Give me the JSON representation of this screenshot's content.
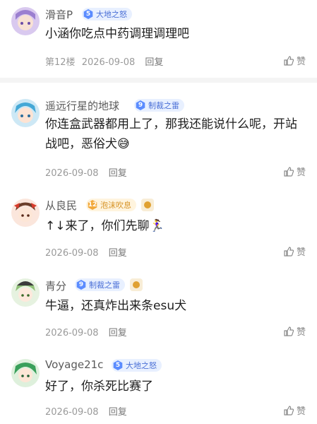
{
  "colors": {
    "accent": "#5b8cff",
    "gold": "#f2a93b",
    "muted": "#9a9a9a"
  },
  "comments": [
    {
      "user": "滑音P",
      "badge_level": "5",
      "badge_text": "大地之怒",
      "text": "小涵你吃点中药调理调理吧",
      "floor": "第12楼",
      "date": "2026-09-08",
      "reply": "回复",
      "like": "赞"
    },
    {
      "user": "遥远行星的地球",
      "badge_level": "9",
      "badge_text": "制裁之雷",
      "text": "你连盒武器都用上了，那我还能说什么呢，开站战吧，恶俗犬😅",
      "date": "2026-09-08",
      "reply": "回复",
      "like": "赞"
    },
    {
      "user": "从良民",
      "badge_level": "12",
      "badge_text": "泡沫吹息",
      "text": "↑↓来了，你们先聊🏃‍♀️",
      "date": "2026-09-08",
      "reply": "回复",
      "like": "赞"
    },
    {
      "user": "青分",
      "badge_level": "9",
      "badge_text": "制裁之雷",
      "text": "牛逼，还真炸出来条esu犬",
      "date": "2026-09-08",
      "reply": "回复",
      "like": "赞"
    },
    {
      "user": "Voyage21c",
      "badge_level": "5",
      "badge_text": "大地之怒",
      "text": "好了，你杀死比赛了",
      "date": "2026-09-08",
      "reply": "回复",
      "like": "赞"
    }
  ]
}
